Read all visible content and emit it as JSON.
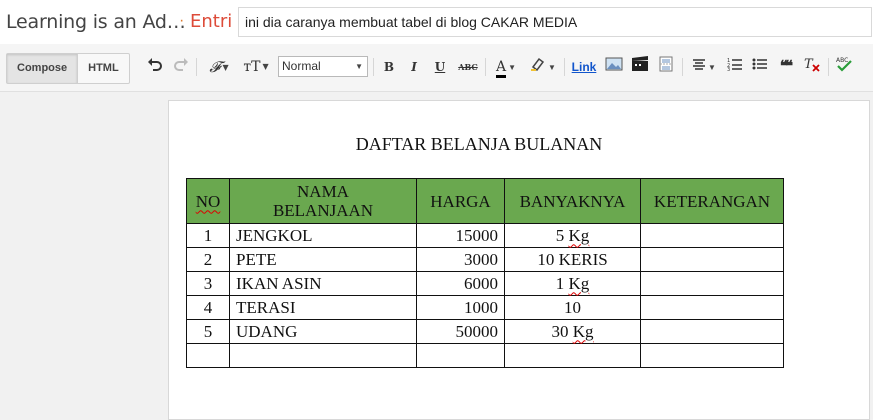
{
  "header": {
    "blog_title": "Learning is an Ad…",
    "crumb_separator": "·",
    "crumb": "Entri",
    "post_title": "ini dia caranya membuat tabel di blog CAKAR MEDIA"
  },
  "toolbar": {
    "compose_label": "Compose",
    "html_label": "HTML",
    "font_family_glyph": "𝓕",
    "font_size_glyph": "ᴛT",
    "format_value": "Normal",
    "bold_label": "B",
    "italic_label": "I",
    "underline_label": "U",
    "strike_label": "ABC",
    "text_color_glyph": "A",
    "link_label": "Link",
    "quote_glyph": "❝❝",
    "colors": {
      "link": "#1155cc",
      "text_color_bar": "#000000",
      "highlight": "#f1c232"
    }
  },
  "post": {
    "heading": "DAFTAR BELANJA BULANAN",
    "table": {
      "header_color": "#6aa84f",
      "columns": [
        "NO",
        "NAMA BELANJAAN",
        "HARGA",
        "BANYAKNYA",
        "KETERANGAN"
      ],
      "rows": [
        {
          "no": "1",
          "name": "JENGKOL",
          "price": "15000",
          "qty": "5",
          "unit": "Kg",
          "note": ""
        },
        {
          "no": "2",
          "name": "PETE",
          "price": "3000",
          "qty": "10",
          "unit": "KERIS",
          "note": ""
        },
        {
          "no": "3",
          "name": "IKAN ASIN",
          "price": "6000",
          "qty": "1",
          "unit": "Kg",
          "note": ""
        },
        {
          "no": "4",
          "name": "TERASI",
          "price": "1000",
          "qty": "10",
          "unit": "",
          "note": ""
        },
        {
          "no": "5",
          "name": "UDANG",
          "price": "50000",
          "qty": "30",
          "unit": "Kg",
          "note": ""
        }
      ]
    }
  }
}
